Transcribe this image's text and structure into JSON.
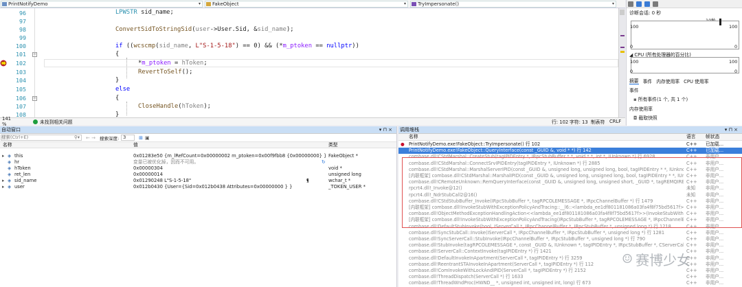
{
  "nav": {
    "file": "PrintNotifyDemo",
    "class": "FakeObject",
    "method": "TryImpersonate()"
  },
  "lines": [
    "96",
    "97",
    "98",
    "99",
    "100",
    "101",
    "102",
    "103",
    "104",
    "105",
    "106",
    "107",
    "108"
  ],
  "code": {
    "l96_a": "LPWSTR",
    "l96_b": " sid_name;",
    "l98_a": "ConvertSidToStringSid",
    "l98_b": "(",
    "l98_c": "user",
    "l98_d": "->User.Sid, &",
    "l98_e": "sid_name",
    "l98_f": ");",
    "l100_a": "if",
    "l100_b": " ((",
    "l100_c": "wcscmp",
    "l100_d": "(",
    "l100_e": "sid_name",
    "l100_f": ", ",
    "l100_g": "L\"S-1-5-18\"",
    "l100_h": ") == 0) && (*",
    "l100_i": "m_ptoken",
    "l100_j": " == ",
    "l100_k": "nullptr",
    "l100_l": "))",
    "l101": "{",
    "l102_a": "*",
    "l102_b": "m_ptoken",
    "l102_c": " = ",
    "l102_d": "hToken",
    "l102_e": ";",
    "l103_a": "RevertToSelf",
    "l103_b": "();",
    "l104": "}",
    "l105": "else",
    "l106": "{",
    "l107_a": "CloseHandle",
    "l107_b": "(",
    "l107_c": "hToken",
    "l107_d": ");",
    "l108": "}"
  },
  "status": {
    "zoom": "141 %",
    "issues": "未找到相关问题",
    "line": "行: 102",
    "char": "字符: 13",
    "mode": "制表符",
    "eol": "CRLF"
  },
  "diagnostics": {
    "session": "诊断会话: 0 秒",
    "time": "10秒",
    "mem_top": "100",
    "mem_bottom": "0",
    "cpu_label": "CPU (所有处理器的百分比)",
    "cpu_top": "100",
    "cpu_bottom": "0",
    "tabs": [
      "摘要",
      "事件",
      "内存使用率",
      "CPU 使用率"
    ],
    "events_title": "事件",
    "events_text": "所有事件(1 个, 共 1 个)",
    "mem_title": "内存使用率",
    "snapshot": "截取快照"
  },
  "autos": {
    "title": "自动窗口",
    "search_placeholder": "搜索(Ctrl+E)",
    "depth_label": "搜索深度:",
    "depth": "3",
    "cols": [
      "名称",
      "值",
      "类型"
    ],
    "rows": [
      {
        "name": "this",
        "value": "0x01283e50 {m_lRefCount=0x00000002 m_ptoken=0x00f9fbb8 {0x00000000} }",
        "type": "FakeObject *"
      },
      {
        "name": "hr",
        "value": "变量已被优化掉，因而不可用。",
        "type": ""
      },
      {
        "name": "hToken",
        "value": "0x00000304",
        "type": "void *"
      },
      {
        "name": "ret_len",
        "value": "0x00000014",
        "type": "unsigned long"
      },
      {
        "name": "sid_name",
        "value": "0x01290248 L\"S-1-5-18\"",
        "type": "wchar_t *",
        "view": "查看"
      },
      {
        "name": "user",
        "value": "0x012b0430 {User={Sid=0x012b0438 Attributes=0x00000000 } }",
        "type": "_TOKEN_USER *"
      }
    ]
  },
  "callstack": {
    "title": "调用堆栈",
    "cols": [
      "名称",
      "语言",
      "帧状态"
    ],
    "rows": [
      {
        "name": "PrintNotifyDemo.exe!FakeObject::TryImpersonate() 行 102",
        "lang": "C++",
        "state": "已加载..."
      },
      {
        "name": "PrintNotifyDemo.exe!FakeObject::QueryInterface(const _GUID &, void * *) 行 142",
        "lang": "C++",
        "state": "已加载..."
      },
      {
        "name": "combase.dll!CStdMarshal::CreateStub(tagIPIDEntry *, IRpcStubBuffer * *, void * *, int *, IUnknown *) 行 6928",
        "lang": "C++",
        "state": "非用户..."
      },
      {
        "name": "combase.dll!CStdMarshal::ConnectSrvIPIDEntry(tagIPIDEntry *, IUnknown *) 行 2885",
        "lang": "C++",
        "state": "非用户..."
      },
      {
        "name": "combase.dll!CStdMarshal::MarshalServerIPID(const _GUID &, unsigned long, unsigned long, bool, tagIPIDEntry * *, IUnknown *, PreventRundo...",
        "lang": "C++",
        "state": "非用户..."
      },
      {
        "name": "[内联框架] combase.dll!CStdMarshal::MarshalIPID(const _GUID &, unsigned long, unsigned long, bool, tagIPIDEntry * *, IUnknown *, PreventRundo...",
        "lang": "C++",
        "state": "非用户..."
      },
      {
        "name": "combase.dll!CRemoteUnknown::RemQueryInterface(const _GUID &, unsigned long, unsigned short, _GUID *, tagREMQIRESULT * *) 行 527",
        "lang": "C++",
        "state": "非用户..."
      },
      {
        "name": "rpcrt4.dll!_Invoke@12()",
        "lang": "未知",
        "state": "非用户..."
      },
      {
        "name": "rpcrt4.dll!_NdrStubCall2@16()",
        "lang": "未知",
        "state": "非用户..."
      },
      {
        "name": "combase.dll!CStdStubBuffer_Invoke(IRpcStubBuffer *, tagRPCOLEMESSAGE *, IRpcChannelBuffer *) 行 1479",
        "lang": "C++",
        "state": "非用户..."
      },
      {
        "name": "[内联框架] combase.dll!InvokeStubWithExceptionPolicyAndTracing::__l6::<lambda_ee1df801181086a03fa4f8f75bd5617f>::operator()() 行 11...",
        "lang": "C++",
        "state": "非用户..."
      },
      {
        "name": "combase.dll!ObjectMethodExceptionHandlingAction<<lambda_ee1df801181086a03fa4f8f75bd5617f>>(InvokeStubWithExceptionPolicyAn...",
        "lang": "C++",
        "state": "非用户..."
      },
      {
        "name": "[内联框架] combase.dll!InvokeStubWithExceptionPolicyAndTracing(IRpcStubBuffer *, tagRPCOLEMESSAGE *, IRpcChannelBuffer *, bool, ISer...",
        "lang": "C++",
        "state": "非用户..."
      },
      {
        "name": "combase.dll!DefaultStubInvoke(bool, IServerCall *, IRpcChannelBuffer *, IRpcStubBuffer *, unsigned long *) 行 1218",
        "lang": "C++",
        "state": "非用户..."
      },
      {
        "name": "combase.dll!SyncStubCall::Invoke(IServerCall *, IRpcChannelBuffer *, IRpcStubBuffer *, unsigned long *) 行 1281",
        "lang": "C++",
        "state": "非用户..."
      },
      {
        "name": "combase.dll!SyncServerCall::StubInvoke(IRpcChannelBuffer *, IRpcStubBuffer *, unsigned long *) 行 790",
        "lang": "C++",
        "state": "非用户..."
      },
      {
        "name": "combase.dll!StubInvoke(tagRPCOLEMESSAGE *, const _GUID &, IUnknown *, tagIPIDEntry *, IRpcStubBuffer *, CServerCall *, tagIPIDEntry *...",
        "lang": "C++",
        "state": "非用户..."
      },
      {
        "name": "combase.dll!ServerCall::ContextInvoke(tagIPIDEntry *) 行 1421",
        "lang": "C++",
        "state": "非用户..."
      },
      {
        "name": "combase.dll!DefaultInvokeInApartment(ServerCall *, tagIPIDEntry *) 行 3259",
        "lang": "C++",
        "state": "非用户..."
      },
      {
        "name": "combase.dll!ReentrantSTAInvokeInApartment(ServerCall *, tagIPIDEntry *) 行 112",
        "lang": "C++",
        "state": "非用户..."
      },
      {
        "name": "combase.dll!ComInvokeWithLockAndIPID(ServerCall *, tagIPIDEntry *) 行 2152",
        "lang": "C++",
        "state": "非用户..."
      },
      {
        "name": "combase.dll!ThreadDispatch(ServerCall *) 行 1633",
        "lang": "C++",
        "state": "非用户..."
      },
      {
        "name": "combase.dll!ThreadWndProc(HWND__ *, unsigned int, unsigned int, long) 行 673",
        "lang": "C++",
        "state": "非用户..."
      }
    ]
  },
  "watermark": "赛博少女"
}
